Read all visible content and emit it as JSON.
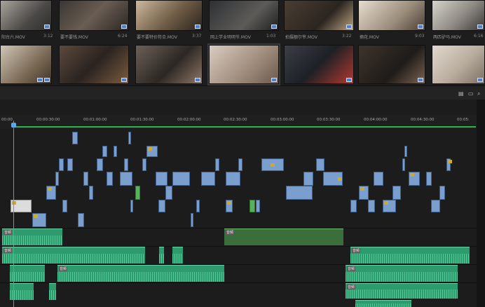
{
  "bin": {
    "row1": [
      {
        "name": "阳台六.MOV",
        "duration": "3:12"
      },
      {
        "name": "要不要钱.MOV",
        "duration": "6:24"
      },
      {
        "name": "要不要特价符合.MOV",
        "duration": "3:37"
      },
      {
        "name": "网上学业明明节.MOV",
        "duration": "1:03"
      },
      {
        "name": "拍摄额尔爷.MOV",
        "duration": "3:22"
      },
      {
        "name": "摘花.MOV",
        "duration": "9:03"
      },
      {
        "name": "两匹驴马.MOV",
        "duration": "6:16"
      }
    ],
    "row2_count": 7
  },
  "status_icons": [
    "list-view-icon",
    "folder-icon",
    "search-icon"
  ],
  "ruler": {
    "ticks": [
      "00:00",
      "00:00:30:00",
      "00:01:00:00",
      "00:01:30:00",
      "00:02:00:00",
      "00:02:30:00",
      "00:03:00:00",
      "00:03:30:00",
      "00:04:00:00",
      "00:04:30:00",
      "00:05:"
    ]
  },
  "clips": {
    "title_label": "字幕",
    "audio_label": "音频"
  },
  "colors": {
    "video_clip": "#7a9fcf",
    "audio_clip": "#2e9b6e",
    "playhead": "#4a9be8",
    "work_area": "#2db34d"
  }
}
